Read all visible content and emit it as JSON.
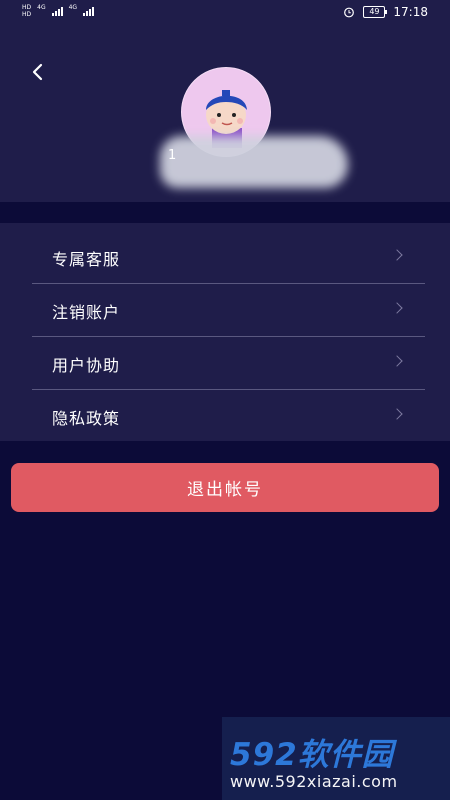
{
  "status_bar": {
    "net_label_top": "HD",
    "net_label_bottom": "HD",
    "signal_1": "4G",
    "signal_2": "4G",
    "battery": "49",
    "time": "17:18"
  },
  "profile": {
    "username": "1"
  },
  "menu": {
    "items": [
      {
        "label": "专属客服"
      },
      {
        "label": "注销账户"
      },
      {
        "label": "用户协助"
      },
      {
        "label": "隐私政策"
      }
    ]
  },
  "logout_label": "退出帐号",
  "watermark": {
    "brand": "592软件园",
    "url": "www.592xiazai.com"
  },
  "colors": {
    "background": "#0c0b38",
    "panel": "#1f1d4a",
    "logout": "#e05a62",
    "watermark_blue": "#2f7de0"
  }
}
